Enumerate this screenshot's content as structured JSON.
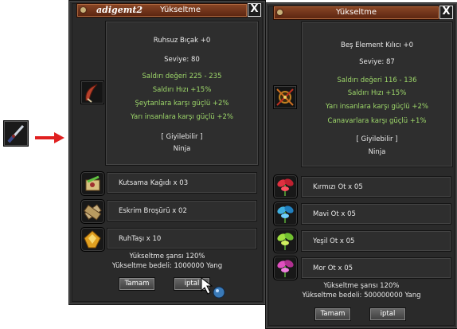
{
  "left_window": {
    "user": "adigemt2",
    "title": "Yükseltme",
    "close_label": "X",
    "item": {
      "name": "Ruhsuz Bıçak +0",
      "level": "Seviye: 80",
      "damage": "Saldırı değeri 225 - 235",
      "speed": "Saldırı Hızı +15%",
      "bonus1": "Şeytanlara karşı güçlü +2%",
      "bonus2": "Yarı insanlara karşı güçlü +2%",
      "wearable": "[ Giyilebilir ]",
      "class": "Ninja"
    },
    "materials": [
      {
        "label": "Kutsama Kağıdı x 03",
        "icon": "blessing-scroll-icon"
      },
      {
        "label": "Eskrim Broşürü x 02",
        "icon": "fencing-brochure-icon"
      },
      {
        "label": "RuhTaşı x 10",
        "icon": "soul-stone-icon"
      }
    ],
    "chance": "Yükseltme şansı 120%",
    "cost": "Yükseltme bedeli: 1000000 Yang",
    "ok_label": "Tamam",
    "cancel_label": "iptal"
  },
  "right_window": {
    "title": "Yükseltme",
    "close_label": "X",
    "item": {
      "name": "Beş Element Kılıcı +0",
      "level": "Seviye: 87",
      "damage": "Saldırı değeri 116 - 136",
      "speed": "Saldırı Hızı +15%",
      "bonus1": "Yarı insanlara karşı güçlü +2%",
      "bonus2": "Canavarlara karşı güçlü +1%",
      "wearable": "[ Giyilebilir ]",
      "class": "Ninja"
    },
    "materials": [
      {
        "label": "Kırmızı Ot x 05",
        "icon": "red-herb-icon"
      },
      {
        "label": "Mavi Ot x 05",
        "icon": "blue-herb-icon"
      },
      {
        "label": "Yeşil Ot x 05",
        "icon": "green-herb-icon"
      },
      {
        "label": "Mor Ot x 05",
        "icon": "purple-herb-icon"
      }
    ],
    "chance": "Yükseltme şansı 120%",
    "cost": "Yükseltme bedeli: 500000000 Yang",
    "ok_label": "Tamam",
    "cancel_label": "iptal"
  },
  "colors": {
    "title_bar": "#7a3a1c",
    "bonus_text": "#9ed86a",
    "arrow": "#e02020"
  }
}
